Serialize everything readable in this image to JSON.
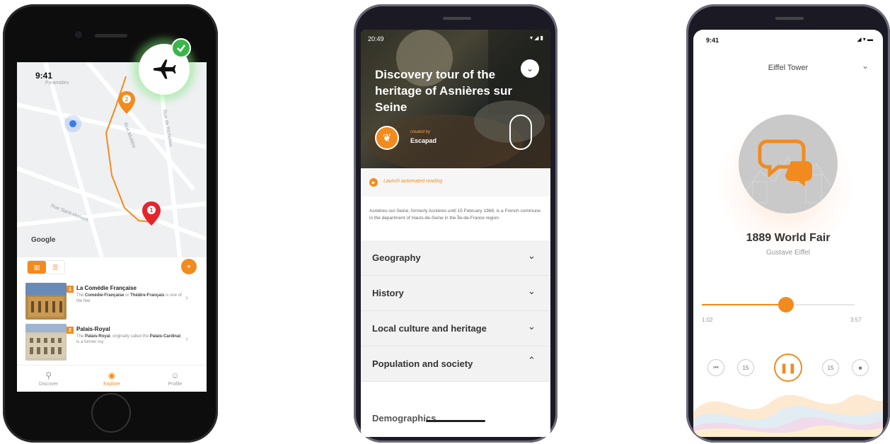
{
  "phone1": {
    "status_time": "9:41",
    "map": {
      "street_labels": [
        "Pyramides",
        "Rue Saint-Honoré",
        "Rue Molière",
        "Rue de Richelieu"
      ],
      "provider": "Google",
      "stop_numbers": [
        "2",
        "1"
      ]
    },
    "places": [
      {
        "number": "1",
        "title": "La Comédie Française",
        "desc_pre": "The ",
        "desc_bold": "Comédie-Française",
        "desc_mid": " or ",
        "desc_bold2": "Théâtre-Français",
        "desc_post": " is one of the few"
      },
      {
        "number": "2",
        "title": "Palais-Royal",
        "desc_pre": "The ",
        "desc_bold": "Palais-Royal",
        "desc_mid": ", originally called the ",
        "desc_bold2": "Palais-Cardinal",
        "desc_post": ", is a former roy"
      }
    ],
    "tabs": [
      {
        "label": "Discover",
        "icon": "search-icon"
      },
      {
        "label": "Explore",
        "icon": "compass-icon"
      },
      {
        "label": "Profile",
        "icon": "profile-icon"
      }
    ],
    "accent": "#f28b1f",
    "check_color": "#3bb54a"
  },
  "phone2": {
    "status_time": "20:49",
    "tour_title": "Discovery tour of the heritage of Asnières sur Seine",
    "created_by": "created by",
    "creator": "Escapad",
    "auto_read": "Launch automated reading",
    "intro": "Asnières-sur-Seine, formerly Asnières until 15 February 1968, is a French commune in the department of Hauts-de-Seine in the Île-de-France region.",
    "sections": [
      {
        "label": "Geography",
        "expanded": false
      },
      {
        "label": "History",
        "expanded": false
      },
      {
        "label": "Local culture and heritage",
        "expanded": false
      },
      {
        "label": "Population and society",
        "expanded": true
      }
    ],
    "subsection": "Demographics"
  },
  "phone3": {
    "status_time": "9:41",
    "title": "Eiffel Tower",
    "track_title": "1889 World Fair",
    "track_author": "Gustave Eiffel",
    "time_current": "1:02",
    "time_total": "3:57",
    "progress": 0.55,
    "rewind_label": "15",
    "forward_label": "15"
  }
}
